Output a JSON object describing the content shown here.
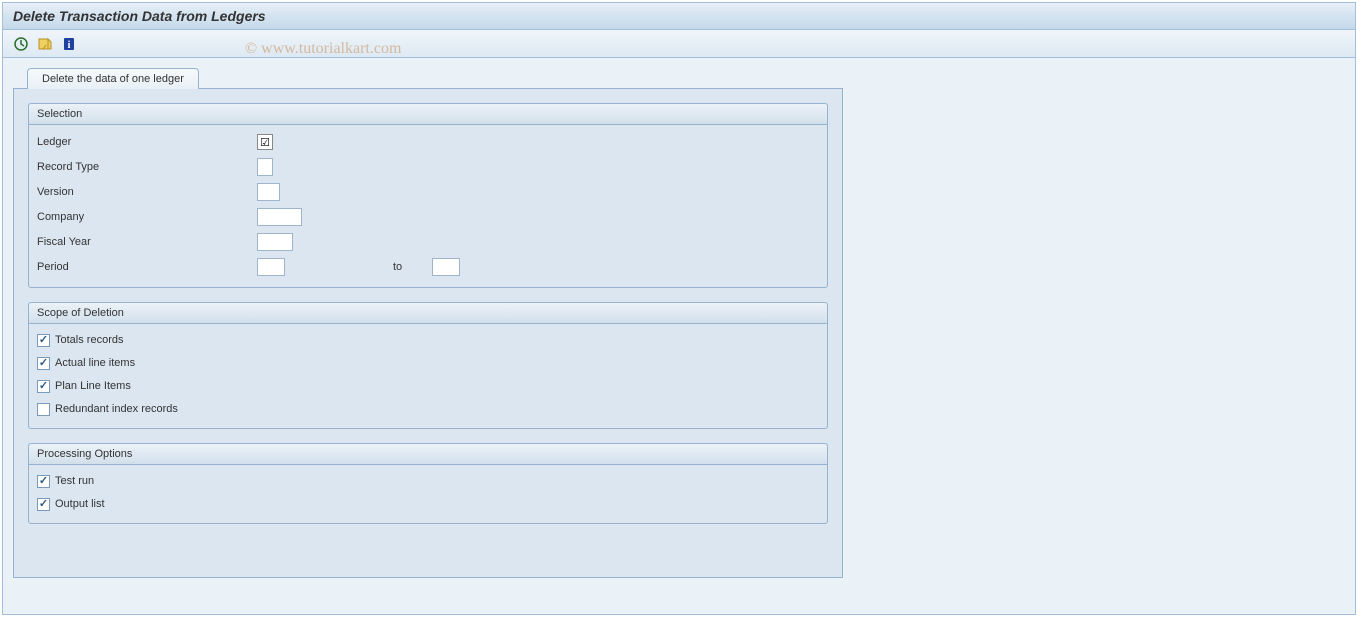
{
  "title": "Delete Transaction Data from Ledgers",
  "watermark": "© www.tutorialkart.com",
  "tab": {
    "label": "Delete the data of one ledger"
  },
  "selection": {
    "title": "Selection",
    "fields": {
      "ledger": "Ledger",
      "record_type": "Record Type",
      "version": "Version",
      "company": "Company",
      "fiscal_year": "Fiscal Year",
      "period": "Period",
      "to": "to"
    },
    "values": {
      "ledger": "",
      "record_type": "",
      "version": "",
      "company": "",
      "fiscal_year": "",
      "period_from": "",
      "period_to": ""
    }
  },
  "scope": {
    "title": "Scope of Deletion",
    "items": [
      {
        "label": "Totals records",
        "checked": true
      },
      {
        "label": "Actual line items",
        "checked": true
      },
      {
        "label": "Plan Line Items",
        "checked": true
      },
      {
        "label": "Redundant index records",
        "checked": false
      }
    ]
  },
  "processing": {
    "title": "Processing Options",
    "items": [
      {
        "label": "Test run",
        "checked": true
      },
      {
        "label": "Output list",
        "checked": true
      }
    ]
  }
}
